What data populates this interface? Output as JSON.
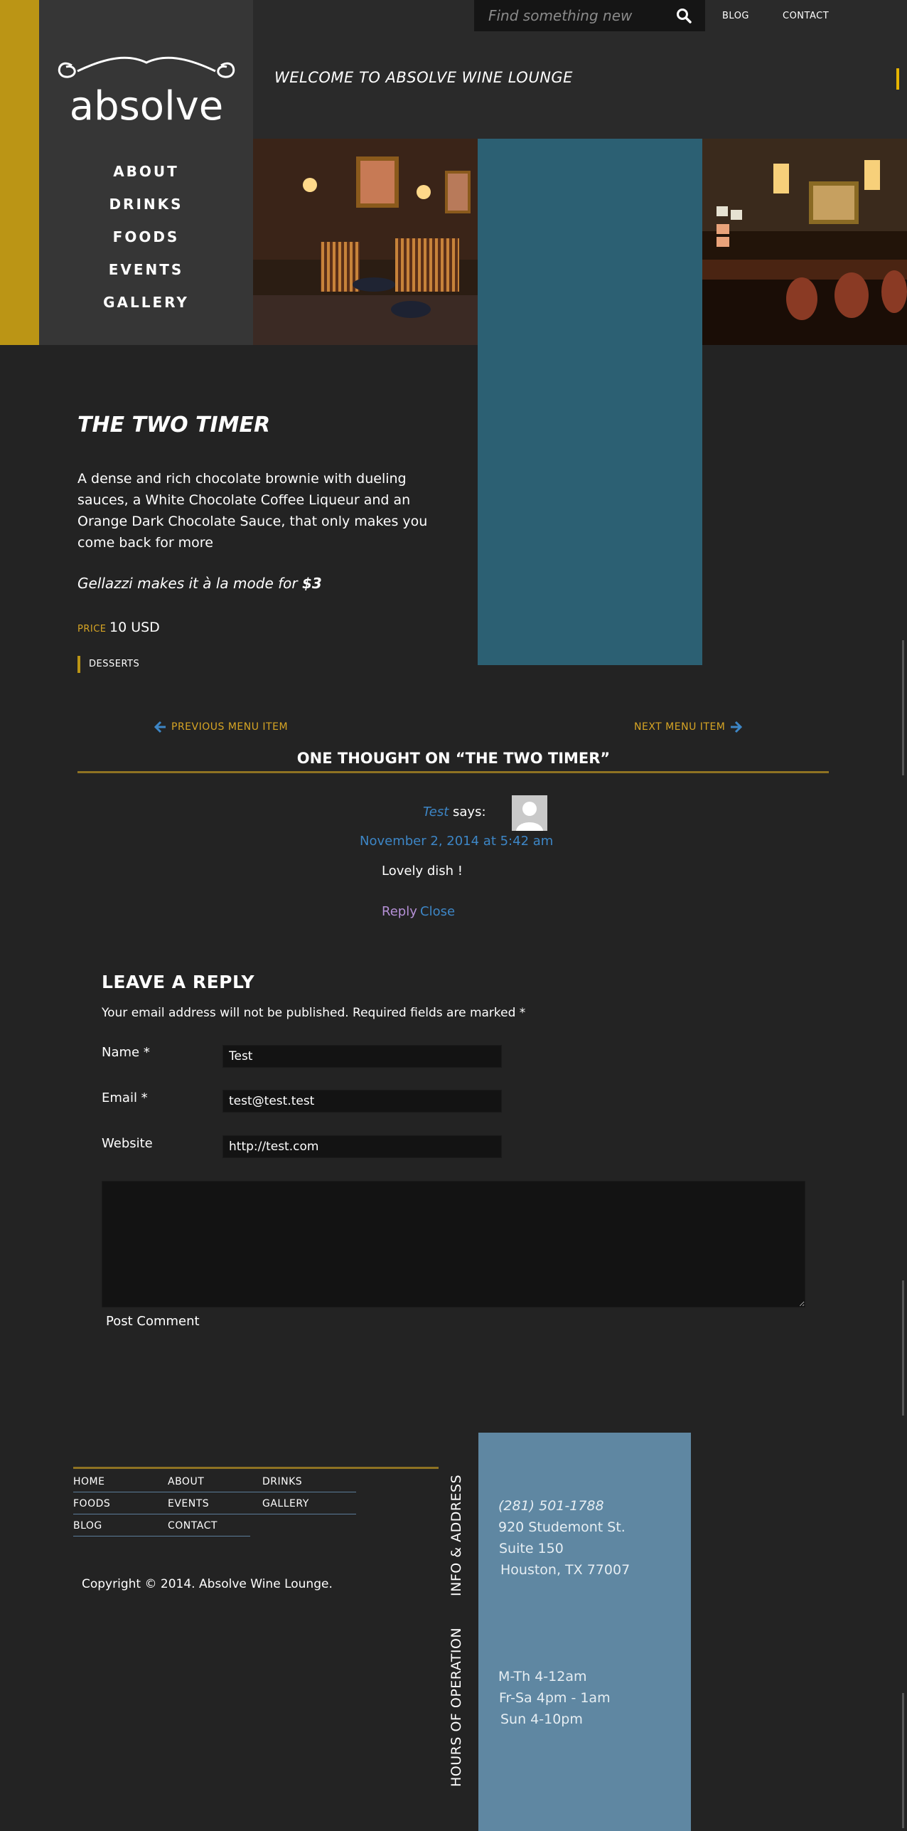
{
  "brand": {
    "logo_text": "absolve"
  },
  "nav": [
    {
      "label": "ABOUT"
    },
    {
      "label": "DRINKS"
    },
    {
      "label": "FOODS"
    },
    {
      "label": "EVENTS"
    },
    {
      "label": "GALLERY"
    }
  ],
  "topbar": {
    "search_placeholder": "Find something new",
    "blog": "BLOG",
    "contact": "CONTACT",
    "welcome": "WELCOME TO ABSOLVE WINE LOUNGE"
  },
  "item": {
    "title": "THE TWO TIMER",
    "description": "A dense and rich chocolate brownie with dueling sauces, a White Chocolate Coffee Liqueur and an Orange Dark Chocolate Sauce, that only makes you come back for more",
    "note_prefix": "Gellazzi makes it à la mode for ",
    "note_price": "$3",
    "price_label": "PRICE",
    "price_value": "10 USD",
    "category": "DESSERTS"
  },
  "postnav": {
    "previous": "PREVIOUS MENU ITEM",
    "next": "NEXT MENU ITEM"
  },
  "comments": {
    "title": "ONE THOUGHT ON “THE TWO TIMER”",
    "author": "Test",
    "says": "says:",
    "date": "November 2, 2014 at 5:42 am",
    "text": "Lovely dish !",
    "reply": "Reply",
    "close": "Close"
  },
  "reply_form": {
    "title": "LEAVE A REPLY",
    "note": "Your email address will not be published. Required fields are marked *",
    "name_label": "Name *",
    "name_value": "Test",
    "email_label": "Email *",
    "email_value": "test@test.test",
    "website_label": "Website",
    "website_value": "http://test.com",
    "comment_value": "",
    "submit": "Post Comment"
  },
  "footer": {
    "links": [
      {
        "label": "HOME"
      },
      {
        "label": "ABOUT"
      },
      {
        "label": "DRINKS"
      },
      {
        "label": "FOODS"
      },
      {
        "label": "EVENTS"
      },
      {
        "label": "GALLERY"
      },
      {
        "label": "BLOG"
      },
      {
        "label": "CONTACT"
      }
    ],
    "copyright": "Copyright © 2014. Absolve Wine Lounge.",
    "info_label": "INFO & ADDRESS",
    "phone": "(281) 501-1788",
    "address1": "920 Studemont St.",
    "address2": "Suite 150",
    "address3": "Houston, TX 77007",
    "hours_label": "HOURS OF OPERATION",
    "hours1": "M-Th 4-12am",
    "hours2": "Fr-Sa 4pm - 1am",
    "hours3": "Sun 4-10pm"
  },
  "colors": {
    "accent_gold": "#bb9515",
    "link_blue": "#3d86c6",
    "teal_panel": "#2c6073",
    "info_panel": "#5f87a2",
    "background": "#232323"
  }
}
